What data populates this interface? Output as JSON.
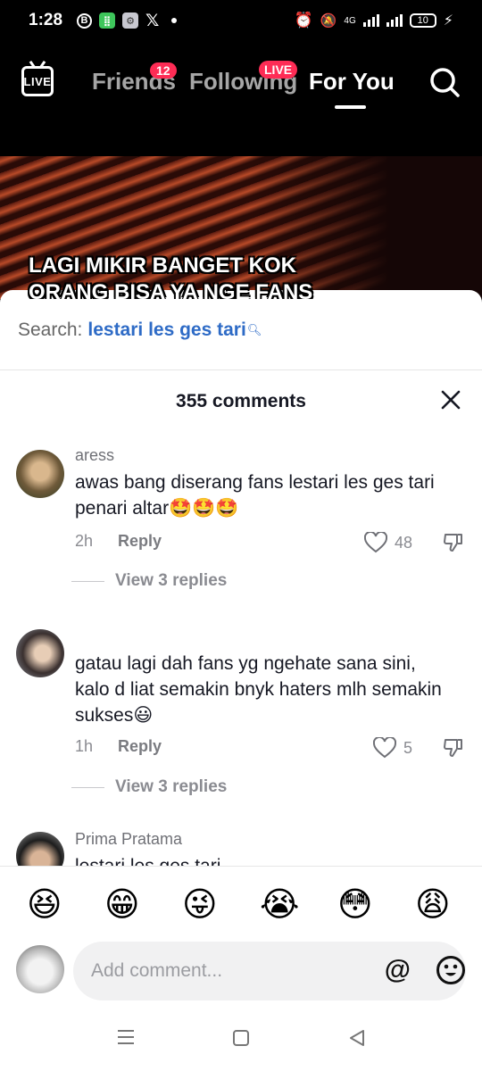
{
  "status_bar": {
    "time": "1:28",
    "network": "4G",
    "battery": "10"
  },
  "top_nav": {
    "live_label": "LIVE",
    "tabs": [
      {
        "label": "Friends",
        "badge": "12"
      },
      {
        "label": "Following",
        "badge": "LIVE"
      },
      {
        "label": "For You",
        "active": true
      }
    ]
  },
  "video": {
    "caption_line1": "LAGI MIKIR BANGET KOK",
    "caption_line2": "ORANG BISA YA NGE FANS"
  },
  "sheet": {
    "search_prefix": "Search:",
    "search_term": "lestari les ges tari",
    "comments_count_label": "355 comments",
    "comments": [
      {
        "author": "aress",
        "text": "awas bang diserang fans lestari les ges tari penari altar🤩🤩🤩",
        "time": "2h",
        "reply_label": "Reply",
        "likes": "48",
        "view_replies": "View 3 replies"
      },
      {
        "author": "",
        "text": "gatau lagi dah fans yg ngehate sana sini, kalo d liat semakin bnyk haters mlh semakin sukses😃",
        "time": "1h",
        "reply_label": "Reply",
        "likes": "5",
        "view_replies": "View 3 replies"
      },
      {
        "author": "Prima Pratama",
        "text": "lestari les ges tari"
      }
    ],
    "emojis": [
      "😆",
      "😁",
      "😜",
      "😭",
      "😳",
      "😩"
    ],
    "compose_placeholder": "Add comment..."
  },
  "colors": {
    "accent_red": "#fe2c55",
    "search_blue": "#2e6bc6"
  }
}
